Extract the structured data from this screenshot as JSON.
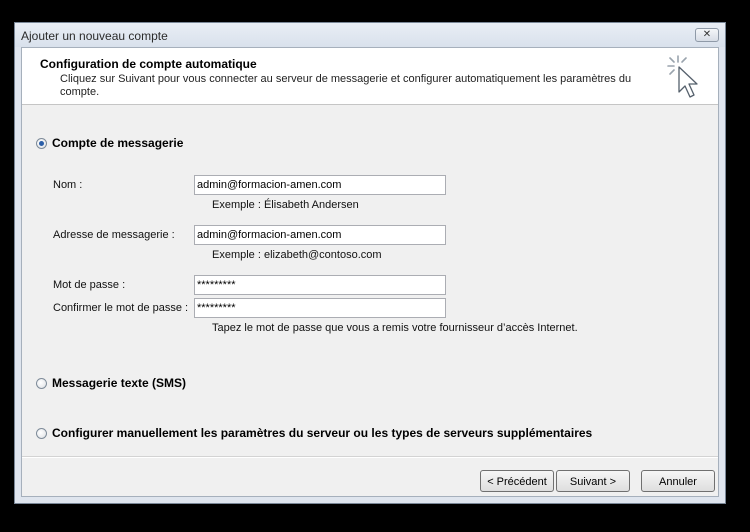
{
  "window": {
    "title": "Ajouter un nouveau compte",
    "close_glyph": "✕"
  },
  "banner": {
    "title": "Configuration de compte automatique",
    "description": "Cliquez sur Suivant pour vous connecter au serveur de messagerie et configurer automatiquement les paramètres du compte.",
    "icon": "click-cursor-icon"
  },
  "options": {
    "email_account": {
      "label": "Compte de messagerie",
      "selected": true
    },
    "sms": {
      "label": "Messagerie texte (SMS)",
      "selected": false
    },
    "manual": {
      "label": "Configurer manuellement les paramètres du serveur ou les types de serveurs supplémentaires",
      "selected": false
    }
  },
  "form": {
    "name": {
      "label": "Nom :",
      "value": "admin@formacion-amen.com",
      "hint": "Exemple : Élisabeth Andersen"
    },
    "email": {
      "label": "Adresse de messagerie :",
      "value": "admin@formacion-amen.com",
      "hint": "Exemple : elizabeth@contoso.com"
    },
    "password": {
      "label": "Mot de passe :",
      "value": "*********"
    },
    "confirm_password": {
      "label": "Confirmer le mot de passe :",
      "value": "*********"
    },
    "password_hint": "Tapez le mot de passe que vous a remis votre fournisseur d’accès Internet."
  },
  "buttons": {
    "back": "< Précédent",
    "next": "Suivant >",
    "cancel": "Annuler"
  },
  "colors": {
    "window_frame": "#dfe5ee",
    "client": "#f0f0f0",
    "radio_dot": "#2a5ea8"
  }
}
